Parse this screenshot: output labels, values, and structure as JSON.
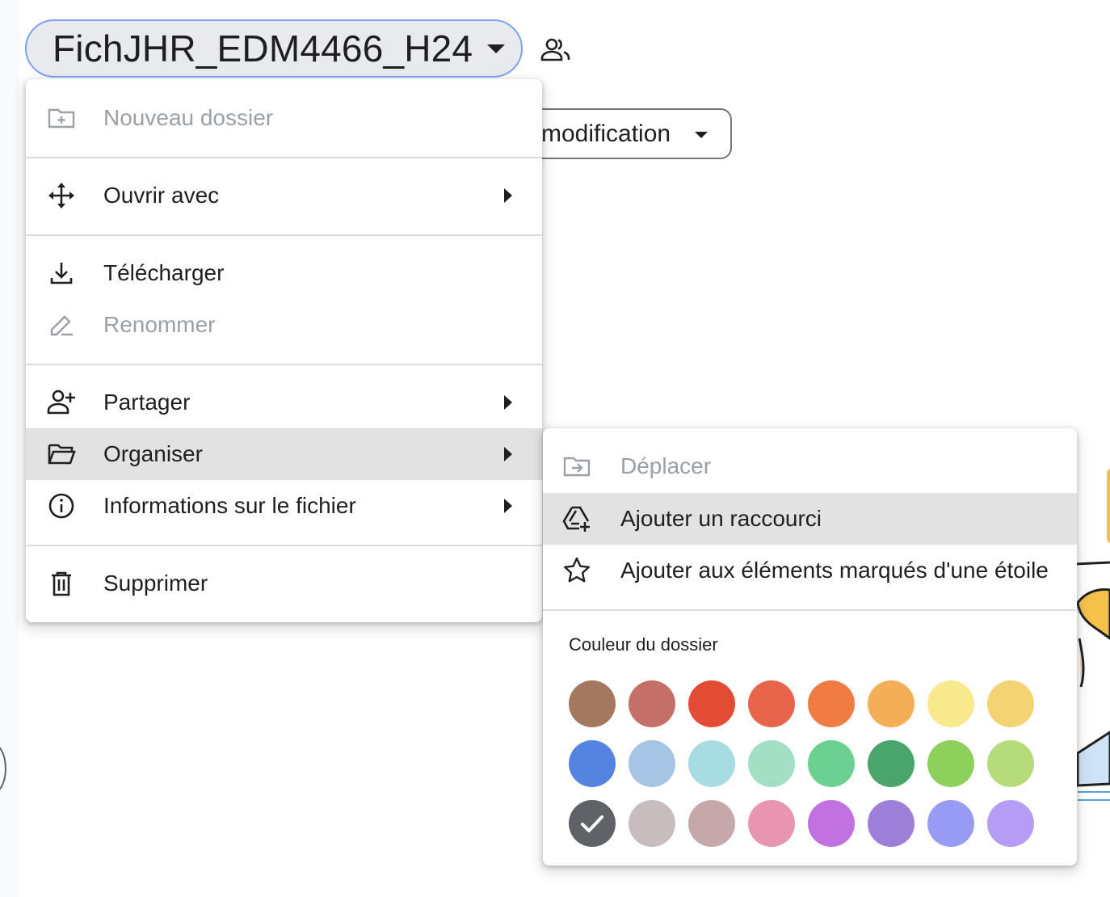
{
  "header": {
    "folder_title": "FichJHR_EDM4466_H24",
    "shared_icon": "people-icon"
  },
  "filter": {
    "label": "modification"
  },
  "context_menu": {
    "items": [
      {
        "label": "Nouveau dossier",
        "icon": "new-folder-icon",
        "disabled": true
      },
      {
        "label": "Ouvrir avec",
        "icon": "open-with-icon",
        "submenu": true
      },
      {
        "label": "Télécharger",
        "icon": "download-icon"
      },
      {
        "label": "Renommer",
        "icon": "rename-icon",
        "disabled": true
      },
      {
        "label": "Partager",
        "icon": "add-person-icon",
        "submenu": true
      },
      {
        "label": "Organiser",
        "icon": "folder-open-icon",
        "submenu": true,
        "highlighted": true
      },
      {
        "label": "Informations sur le fichier",
        "icon": "info-icon",
        "submenu": true
      },
      {
        "label": "Supprimer",
        "icon": "trash-icon"
      }
    ]
  },
  "organize_submenu": {
    "items": [
      {
        "label": "Déplacer",
        "icon": "move-folder-icon",
        "disabled": true
      },
      {
        "label": "Ajouter un raccourci",
        "icon": "add-shortcut-icon",
        "highlighted": true
      },
      {
        "label": "Ajouter aux éléments marqués d'une étoile",
        "icon": "star-icon"
      }
    ],
    "color_section_title": "Couleur du dossier",
    "selected_color": "#5f6368",
    "colors": [
      [
        "#a4775f",
        "#c46f68",
        "#e34c34",
        "#e8644a",
        "#f07c43",
        "#f4ae57",
        "#f8e98d",
        "#f4d372"
      ],
      [
        "#5484e0",
        "#a6c4e4",
        "#a8dce3",
        "#a3dfc4",
        "#6dd093",
        "#4aa56c",
        "#8dd05c",
        "#b6db7a"
      ],
      [
        "#5f6368",
        "#c7bdbf",
        "#c6a7aa",
        "#e795b1",
        "#c271e0",
        "#9d7ed9",
        "#979bf4",
        "#b59cf5"
      ]
    ]
  }
}
